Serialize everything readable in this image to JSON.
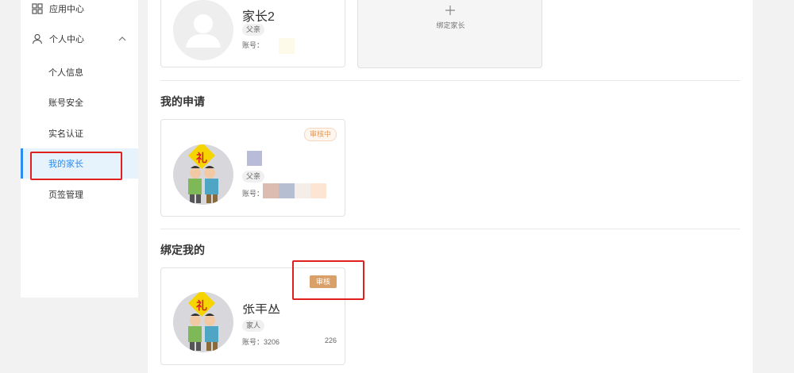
{
  "sidebar": {
    "app_center": "应用中心",
    "personal_center": "个人中心",
    "items": [
      {
        "label": "个人信息"
      },
      {
        "label": "账号安全"
      },
      {
        "label": "实名认证"
      },
      {
        "label": "我的家长"
      },
      {
        "label": "页签管理"
      }
    ]
  },
  "parents": {
    "card1": {
      "name": "家长2",
      "relation": "父亲",
      "account_label": "账号："
    },
    "bind_label": "绑定家长"
  },
  "my_applications": {
    "title": "我的申请",
    "card": {
      "status": "审核中",
      "relation": "父亲",
      "account_label": "账号："
    }
  },
  "bound_me": {
    "title": "绑定我的",
    "card": {
      "name": "张丰丛",
      "relation": "家人",
      "account_label": "账号：3206",
      "account_suffix": "226",
      "review_label": "审核"
    }
  },
  "colors": {
    "accent": "#2d8cf0",
    "highlight": "#e01f1f",
    "pending": "#e9974d",
    "review_button": "#d9a069"
  }
}
